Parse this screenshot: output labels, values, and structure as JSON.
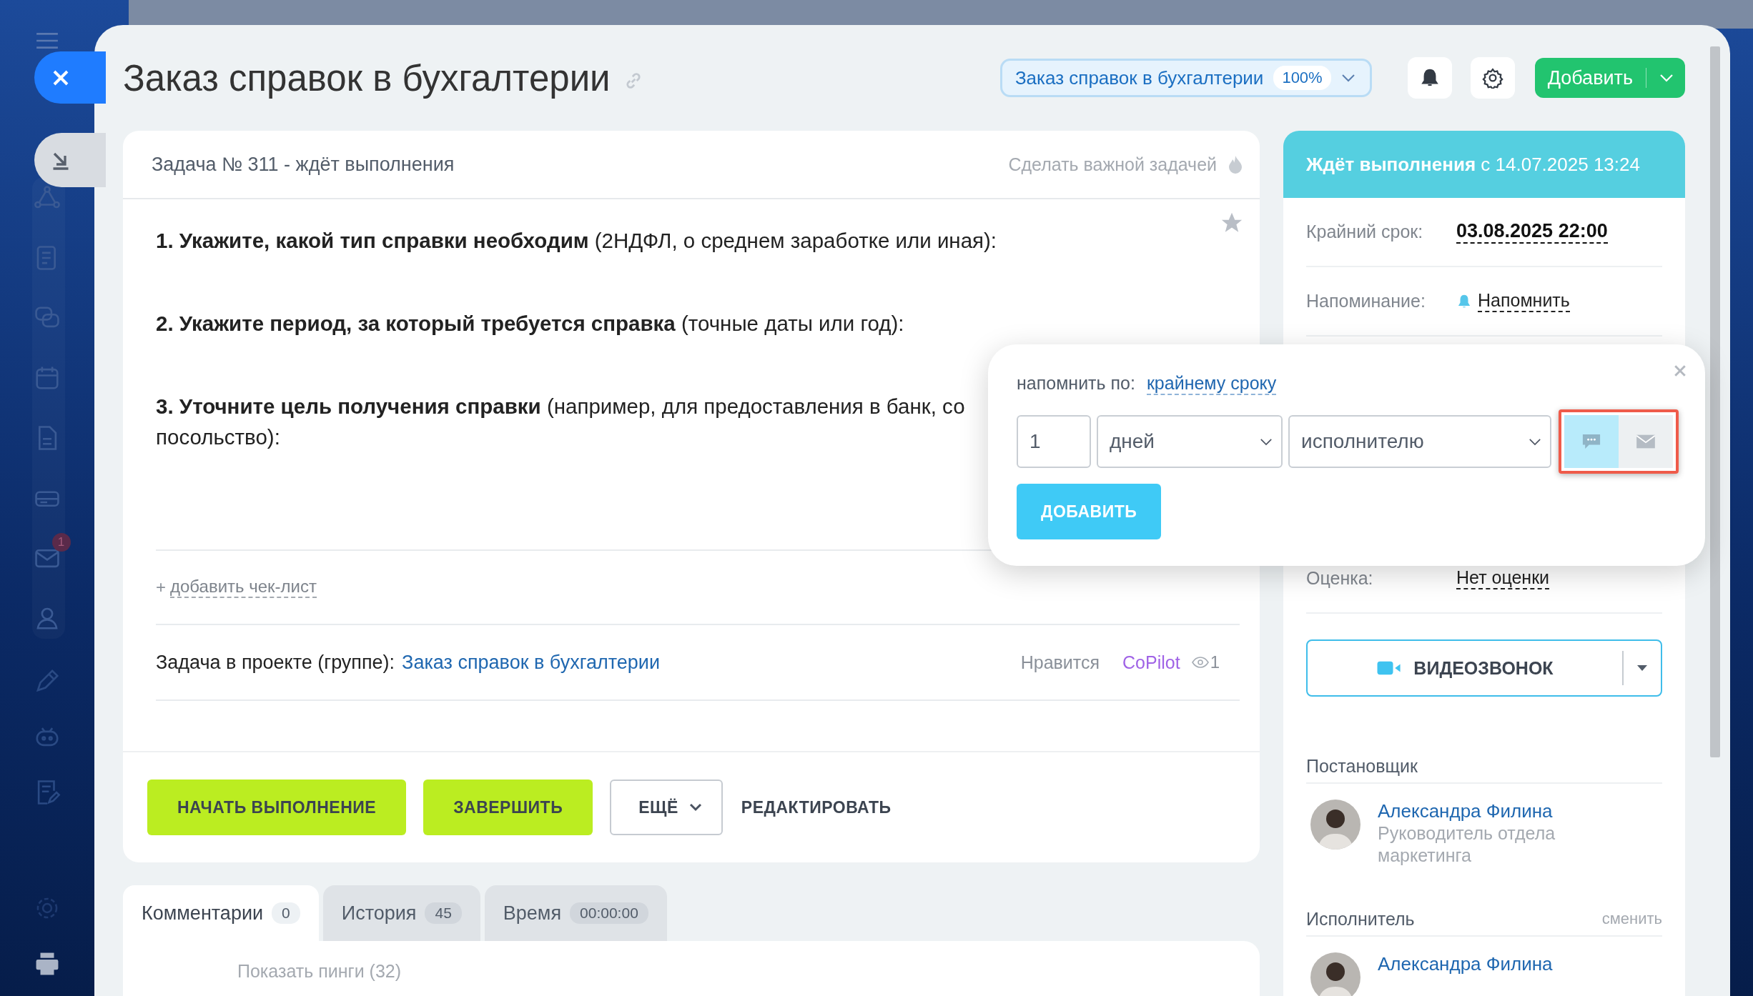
{
  "sidebar": {
    "mail_badge": "1"
  },
  "title": "Заказ справок в бухгалтерии",
  "header": {
    "project": "Заказ справок в бухгалтерии",
    "progress": "100%",
    "add_button": "Добавить"
  },
  "task": {
    "heading": "Задача № 311 - ждёт выполнения",
    "important_link": "Сделать важной задачей",
    "starred": false,
    "description": [
      "**1. Укажите, какой тип справки необходим** (2НДФЛ, о среднем заработке или иная):",
      "**2. Укажите период, за который требуется справка** (точные даты или год):",
      "**3. Уточните цель получения справки** (например, для предоставления в банк, со\nпосольство):"
    ],
    "add_checklist": {
      "plus": "+",
      "label": "добавить чек-лист"
    },
    "project_row": {
      "label": "Задача в проекте (группе):",
      "project": "Заказ справок в бухгалтерии",
      "like": "Нравится",
      "copilot": "CoPilot",
      "views": "1"
    }
  },
  "actions": {
    "start": "НАЧАТЬ ВЫПОЛНЕНИЕ",
    "finish": "ЗАВЕРШИТЬ",
    "more": "ЕЩЁ",
    "edit": "РЕДАКТИРОВАТЬ"
  },
  "tabs": [
    {
      "label": "Комментарии",
      "count": "0",
      "selected": true
    },
    {
      "label": "История",
      "count": "45",
      "selected": false
    },
    {
      "label": "Время",
      "count": "00:00:00",
      "selected": false
    }
  ],
  "comments": {
    "show_pings": "Показать пинги (32)"
  },
  "status": {
    "state": "Ждёт выполнения",
    "since": "с 14.07.2025 13:24"
  },
  "fields": [
    {
      "kind": "date",
      "label": "Крайний срок:",
      "value": "03.08.2025 22:00"
    },
    {
      "kind": "reminder",
      "label": "Напоминание:",
      "value": "Напомнить"
    }
  ],
  "rating": {
    "label": "Оценка:",
    "value": "Нет оценки"
  },
  "videocall": "ВИДЕОЗВОНОК",
  "people": [
    {
      "role": "Постановщик",
      "name": "Александра Филина",
      "position": "Руководитель отдела маркетинга"
    },
    {
      "role": "Исполнитель",
      "action": "сменить",
      "name": "Александра Филина"
    }
  ],
  "reminder_popup": {
    "label": "напомнить по:",
    "mode": "крайнему сроку",
    "amount": "1",
    "unit": "дней",
    "recipient": "исполнителю",
    "highlight": true,
    "channels": [
      {
        "kind": "chat",
        "selected": true
      },
      {
        "kind": "mail",
        "selected": false
      }
    ],
    "add_button": "ДОБАВИТЬ"
  }
}
